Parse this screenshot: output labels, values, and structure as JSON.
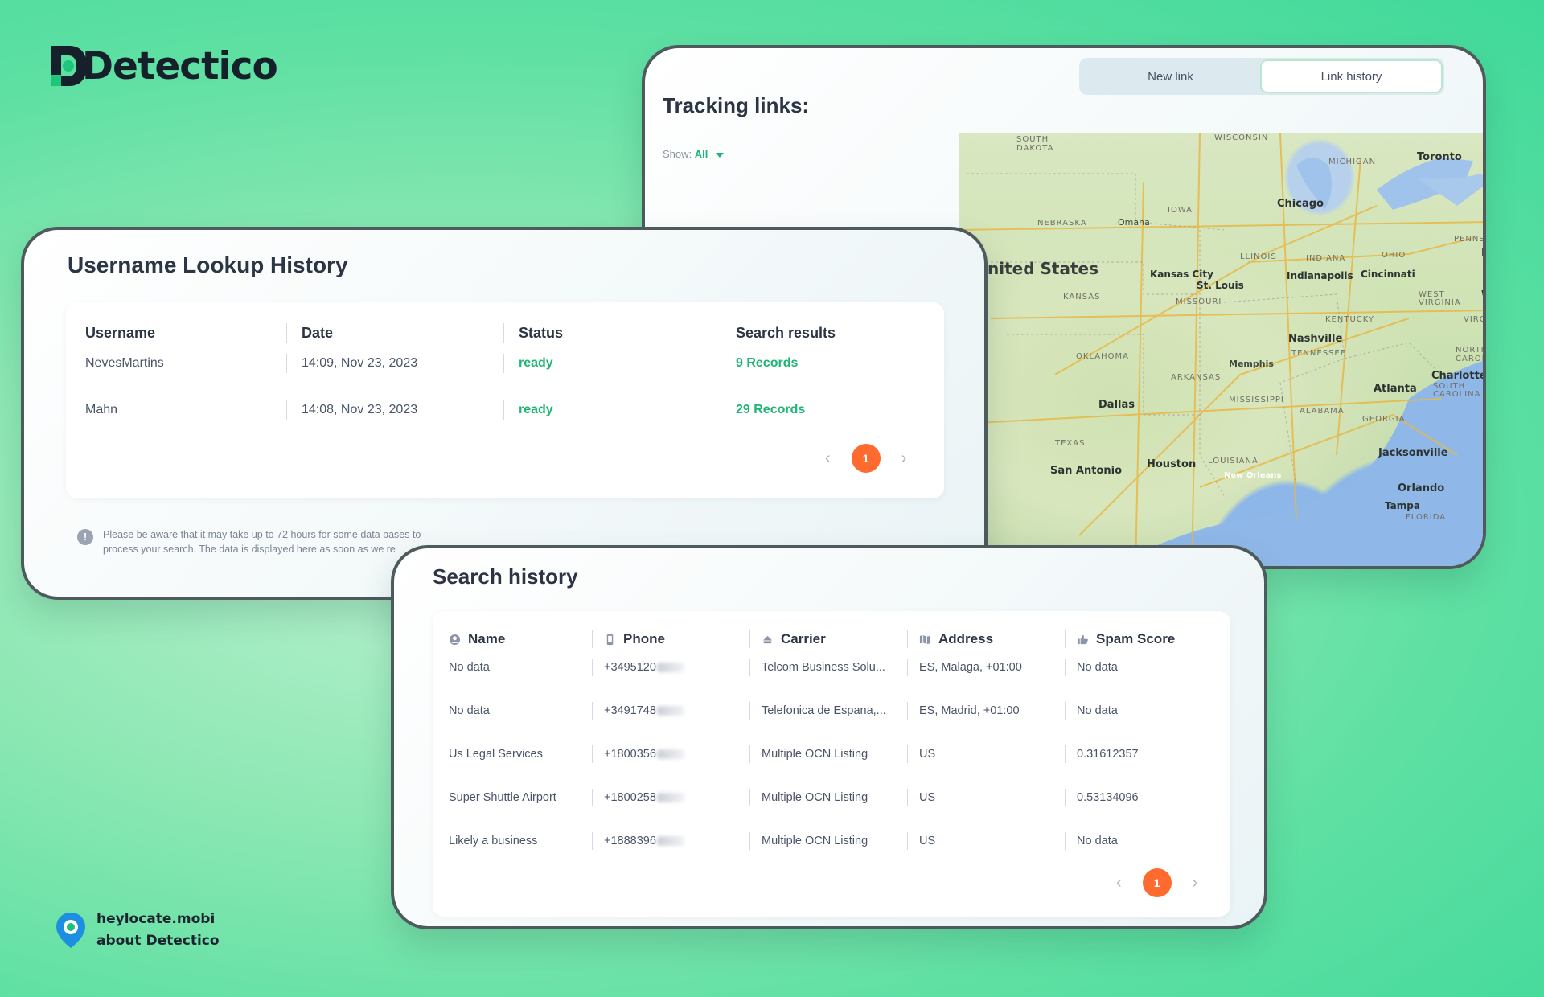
{
  "brand": {
    "name": "Detectico"
  },
  "tracking": {
    "tabs": [
      "New link",
      "Link history"
    ],
    "active_tab": "Link history",
    "title": "Tracking links:",
    "show_label": "Show:",
    "show_value": "All",
    "map": {
      "labels": {
        "south_dakota": "SOUTH\nDAKOTA",
        "wisconsin": "WISCONSIN",
        "michigan": "MICHIGAN",
        "toronto": "Toronto",
        "iowa": "IOWA",
        "chicago": "Chicago",
        "nebraska": "NEBRASKA",
        "omaha": "Omaha",
        "illinois": "ILLINOIS",
        "indiana": "INDIANA",
        "ohio": "OHIO",
        "penns": "PENNS",
        "united_states": "nited States",
        "kansas_city": "Kansas City",
        "st_louis": "St. Louis",
        "indianapolis": "Indianapolis",
        "cincinnati": "Cincinnati",
        "kansas": "KANSAS",
        "missouri": "MISSOURI",
        "west_virginia": "WEST\nVIRGINIA",
        "kentucky": "KENTUCKY",
        "virgin": "VIRGIN",
        "nashville": "Nashville",
        "oklahoma": "OKLAHOMA",
        "tennessee": "TENNESSEE",
        "north_carolina": "NORTH\nCAROLIN",
        "memphis": "Memphis",
        "charlotte": "Charlotte",
        "arkansas": "ARKANSAS",
        "atlanta": "Atlanta",
        "south_carolina": "SOUTH\nCAROLINA",
        "dallas": "Dallas",
        "mississippi": "MISSISSIPPI",
        "alabama": "ALABAMA",
        "georgia": "GEORGIA",
        "texas": "TEXAS",
        "jacksonville": "Jacksonville",
        "louisiana": "LOUISIANA",
        "houston": "Houston",
        "san_antonio": "San Antonio",
        "new_orleans": "New Orleans",
        "orlando": "Orlando",
        "tampa": "Tampa",
        "florida": "FLORIDA",
        "ph": "Ph",
        "w": "W"
      }
    }
  },
  "username_history": {
    "title": "Username Lookup History",
    "headers": [
      "Username",
      "Date",
      "Status",
      "Search results"
    ],
    "rows": [
      {
        "username": "NevesMartins",
        "date": "14:09, Nov 23, 2023",
        "status": "ready",
        "results": "9 Records"
      },
      {
        "username": "Mahn",
        "date": "14:08, Nov 23, 2023",
        "status": "ready",
        "results": "29 Records"
      }
    ],
    "page": "1",
    "notice_line1": "Please be aware that it may take up to 72 hours for some data bases to",
    "notice_line2": "process your search. The data is displayed here as soon as we re"
  },
  "search_history": {
    "title": "Search history",
    "headers": [
      "Name",
      "Phone",
      "Carrier",
      "Address",
      "Spam Score"
    ],
    "header_icons": [
      "user-circle-icon",
      "phone-icon",
      "carrier-icon",
      "map-icon",
      "thumbs-up-icon"
    ],
    "rows": [
      {
        "name": "No data",
        "phone": "+3495120",
        "carrier": "Telcom Business Solu...",
        "address": "ES, Malaga, +01:00",
        "spam": "No data"
      },
      {
        "name": "No data",
        "phone": "+3491748",
        "carrier": "Telefonica de Espana,...",
        "address": "ES, Madrid, +01:00",
        "spam": "No data"
      },
      {
        "name": "Us Legal Services",
        "phone": "+1800356",
        "carrier": "Multiple OCN Listing",
        "address": "US",
        "spam": "0.31612357"
      },
      {
        "name": "Super Shuttle Airport",
        "phone": "+1800258",
        "carrier": "Multiple OCN Listing",
        "address": "US",
        "spam": "0.53134096"
      },
      {
        "name": "Likely a business",
        "phone": "+1888396",
        "carrier": "Multiple OCN Listing",
        "address": "US",
        "spam": "No data"
      }
    ],
    "page": "1"
  },
  "footer": {
    "line1": "heylocate.mobi",
    "line2": "about Detectico"
  },
  "colors": {
    "accent_green": "#1fb574",
    "page_orange": "#ff6a2e",
    "frame": "#4e5a5c"
  }
}
